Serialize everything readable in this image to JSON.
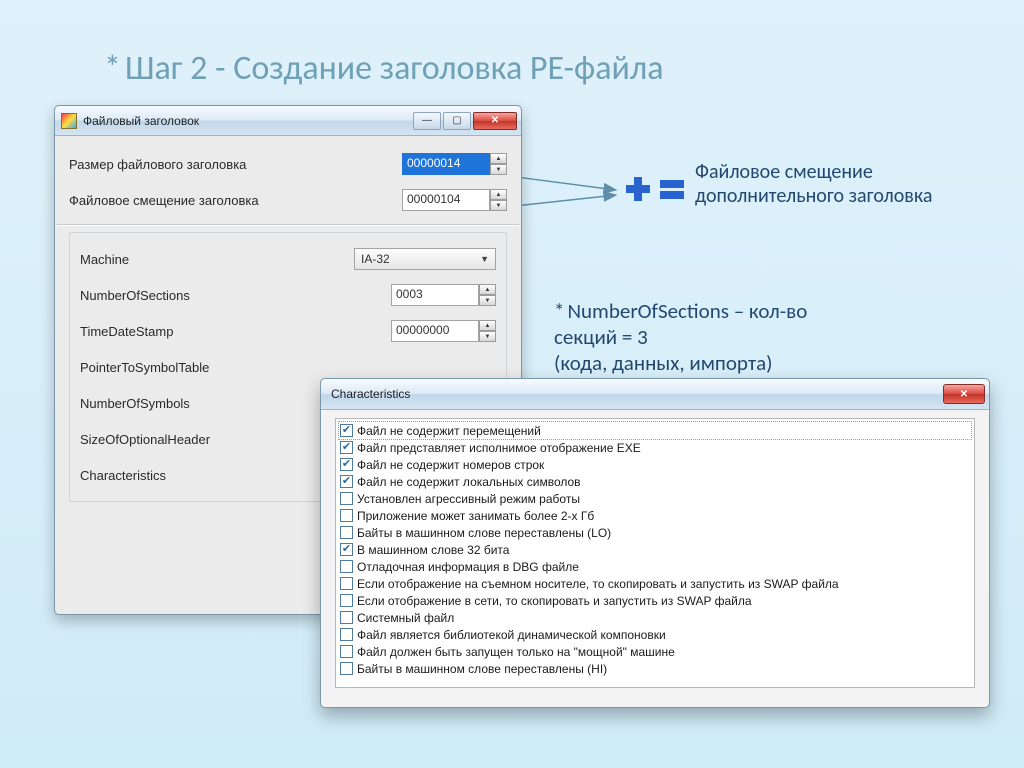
{
  "slide": {
    "asterisk": "*",
    "title": "Шаг 2 - Создание заголовка PE-файла"
  },
  "win1": {
    "title": "Файловый заголовок",
    "size_label": "Размер файлового заголовка",
    "size_value": "00000014",
    "offset_label": "Файловое смещение заголовка",
    "offset_value": "00000104",
    "machine_label": "Machine",
    "machine_value": "IA-32",
    "numsec_label": "NumberOfSections",
    "numsec_value": "0003",
    "tds_label": "TimeDateStamp",
    "tds_value": "00000000",
    "pst_label": "PointerToSymbolTable",
    "nsym_label": "NumberOfSymbols",
    "soh_label": "SizeOfOptionalHeader",
    "char_label": "Characteristics"
  },
  "annot1": "Файловое смещение дополнительного заголовка",
  "annot2_line1": "NumberOfSections – кол-во",
  "annot2_line2": "секций = 3",
  "annot2_line3": "(кода, данных, импорта)",
  "win2_title": "Characteristics",
  "char_items": [
    {
      "checked": true,
      "label": "Файл не содержит перемещений"
    },
    {
      "checked": true,
      "label": "Файл представляет исполнимое отображение EXE"
    },
    {
      "checked": true,
      "label": "Файл не содержит номеров строк"
    },
    {
      "checked": true,
      "label": "Файл не содержит локальных символов"
    },
    {
      "checked": false,
      "label": "Установлен агрессивный режим работы"
    },
    {
      "checked": false,
      "label": "Приложение может занимать более 2-х Гб"
    },
    {
      "checked": false,
      "label": "Байты в машинном слове переставлены (LO)"
    },
    {
      "checked": true,
      "label": "В машинном слове 32 бита"
    },
    {
      "checked": false,
      "label": "Отладочная информация в DBG файле"
    },
    {
      "checked": false,
      "label": "Если отображение на съемном носителе, то скопировать и запустить из SWAP файла"
    },
    {
      "checked": false,
      "label": "Если отображение в сети, то скопировать и запустить из SWAP файла"
    },
    {
      "checked": false,
      "label": "Системный файл"
    },
    {
      "checked": false,
      "label": "Файл является библиотекой динамической компоновки"
    },
    {
      "checked": false,
      "label": "Файл должен быть запущен только на \"мощной\" машине"
    },
    {
      "checked": false,
      "label": "Байты в машинном слове переставлены (HI)"
    }
  ]
}
